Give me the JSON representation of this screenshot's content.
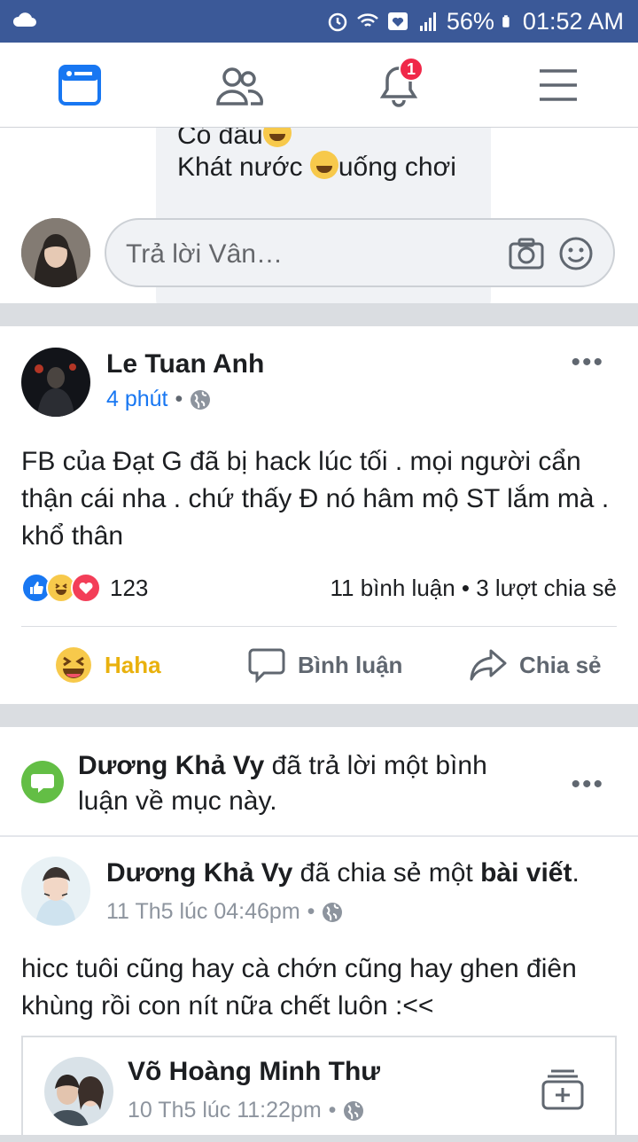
{
  "status_bar": {
    "battery": "56%",
    "time": "01:52 AM"
  },
  "nav": {
    "tabs": [
      "news-feed",
      "friends",
      "notifications",
      "menu"
    ],
    "notification_count": "1"
  },
  "comment_bubble": {
    "line1": "Có đâu",
    "line2_before": "Khát nước ",
    "line2_after": "uống chơi"
  },
  "reply_box": {
    "placeholder": "Trả lời Vân…"
  },
  "post1": {
    "author": "Le Tuan Anh",
    "time": "4 phút",
    "text": "FB của Đạt G đã bị hack lúc tối . mọi người cẩn thận cái nha . chứ thấy Đ nó hâm mộ ST lắm mà . khổ thân",
    "reaction_count": "123",
    "comments_shares": "11 bình luận • 3 lượt chia sẻ",
    "actions": {
      "haha": "Haha",
      "comment": "Bình luận",
      "share": "Chia sẻ"
    },
    "colors": {
      "haha_active": "#e9b10d",
      "like_blue": "#1877f2",
      "love_red": "#f33e58"
    }
  },
  "notice": {
    "name": "Dương Khả Vy",
    "text": " đã trả lời một bình luận về mục này."
  },
  "post2": {
    "author": "Dương Khả Vy",
    "action_text": " đã chia sẻ một ",
    "action_bold": "bài viết",
    "time": "11 Th5 lúc 04:46pm",
    "text": "hicc tuôi cũng hay cà chớn cũng hay ghen điên khùng rồi con nít nữa chết luôn :<<",
    "shared": {
      "author": "Võ Hoàng Minh Thư",
      "time": "10 Th5 lúc 11:22pm"
    }
  }
}
